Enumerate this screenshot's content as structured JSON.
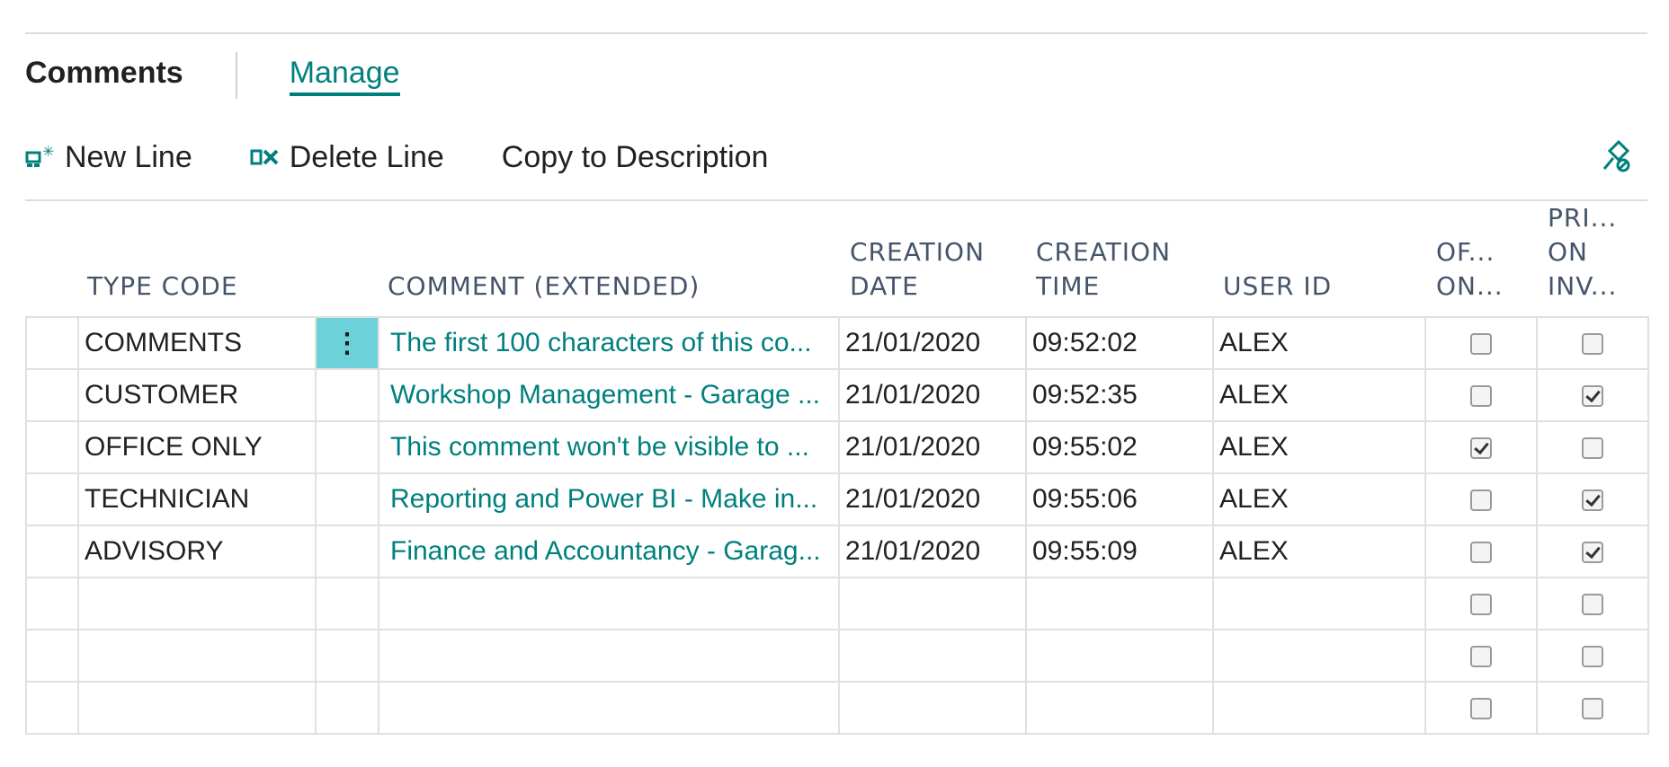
{
  "tabs": {
    "active": "Comments",
    "manage": "Manage"
  },
  "toolbar": {
    "new_line": "New Line",
    "delete_line": "Delete Line",
    "copy_to_description": "Copy to Description"
  },
  "columns": {
    "type_code": "TYPE CODE",
    "comment": "COMMENT (EXTENDED)",
    "creation_date_1": "CREATION",
    "creation_date_2": "DATE",
    "creation_time_1": "CREATION",
    "creation_time_2": "TIME",
    "user_id": "USER ID",
    "office_only_1": "OF...",
    "office_only_2": "ON...",
    "print_invoice_1": "PRI...",
    "print_invoice_2": "ON",
    "print_invoice_3": "INV..."
  },
  "rows": [
    {
      "type_code": "COMMENTS",
      "comment": "The first 100 characters of this co...",
      "date": "21/01/2020",
      "time": "09:52:02",
      "user": "ALEX",
      "office_only": false,
      "print_on_invoice": false
    },
    {
      "type_code": "CUSTOMER",
      "comment": "Workshop Management - Garage ...",
      "date": "21/01/2020",
      "time": "09:52:35",
      "user": "ALEX",
      "office_only": false,
      "print_on_invoice": true
    },
    {
      "type_code": "OFFICE ONLY",
      "comment": "This comment won't be visible to ...",
      "date": "21/01/2020",
      "time": "09:55:02",
      "user": "ALEX",
      "office_only": true,
      "print_on_invoice": false
    },
    {
      "type_code": "TECHNICIAN",
      "comment": "Reporting and Power BI - Make in...",
      "date": "21/01/2020",
      "time": "09:55:06",
      "user": "ALEX",
      "office_only": false,
      "print_on_invoice": true
    },
    {
      "type_code": "ADVISORY",
      "comment": "Finance and Accountancy - Garag...",
      "date": "21/01/2020",
      "time": "09:55:09",
      "user": "ALEX",
      "office_only": false,
      "print_on_invoice": true
    }
  ],
  "empty_rows": 3,
  "row_menu_glyph": "⋮",
  "colors": {
    "accent": "#00807d",
    "selected_cell": "#6dd1d9",
    "header_text": "#44546a"
  }
}
